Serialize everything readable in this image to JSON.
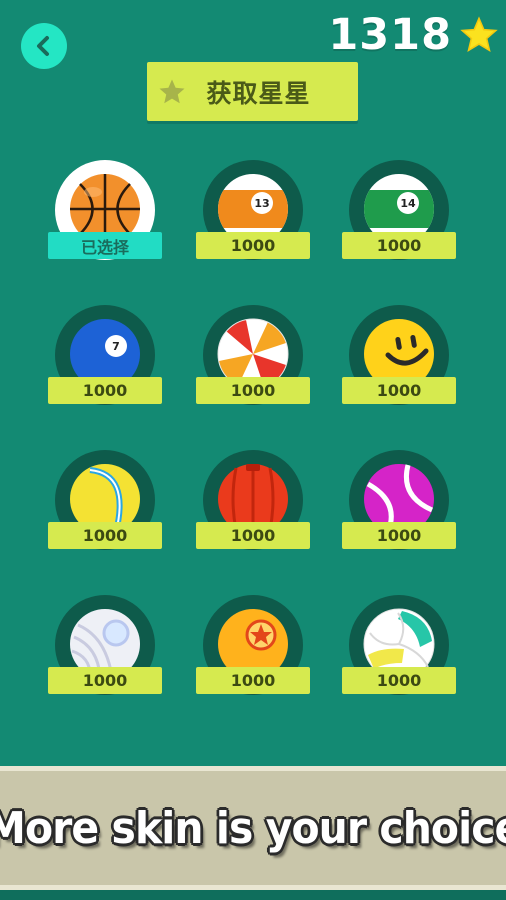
{
  "header": {
    "back_icon": "chevron-left-icon",
    "star_count": "1318",
    "star_icon": "star-icon",
    "star_color": "#fbe21f"
  },
  "get_stars_button": {
    "label": "获取星星",
    "icon": "star-icon"
  },
  "balls": [
    {
      "id": "basketball",
      "icon": "basketball-icon",
      "label": "已选择",
      "selected": true
    },
    {
      "id": "billiard-13",
      "icon": "billiard-ball-13-icon",
      "number": "13",
      "label": "1000",
      "selected": false
    },
    {
      "id": "billiard-14",
      "icon": "billiard-ball-14-icon",
      "number": "14",
      "label": "1000",
      "selected": false
    },
    {
      "id": "billiard-7",
      "icon": "billiard-ball-7-icon",
      "number": "7",
      "label": "1000",
      "selected": false
    },
    {
      "id": "beach-ball",
      "icon": "beach-ball-icon",
      "label": "1000",
      "selected": false
    },
    {
      "id": "smiley-ball",
      "icon": "smiley-ball-icon",
      "label": "1000",
      "selected": false
    },
    {
      "id": "tennis-yellow",
      "icon": "tennis-ball-yellow-icon",
      "label": "1000",
      "selected": false
    },
    {
      "id": "red-ball",
      "icon": "red-ball-icon",
      "label": "1000",
      "selected": false
    },
    {
      "id": "tennis-pink",
      "icon": "tennis-ball-pink-icon",
      "label": "1000",
      "selected": false
    },
    {
      "id": "white-ball",
      "icon": "white-ball-icon",
      "label": "1000",
      "selected": false
    },
    {
      "id": "star-ball",
      "icon": "star-ball-icon",
      "label": "1000",
      "selected": false
    },
    {
      "id": "volleyball",
      "icon": "volleyball-icon",
      "label": "1000",
      "selected": false
    }
  ],
  "banner": {
    "text": "More skin is your choice"
  },
  "colors": {
    "background": "#138a73",
    "accent_yellow": "#d6ea4f",
    "accent_teal": "#22dcc4"
  }
}
